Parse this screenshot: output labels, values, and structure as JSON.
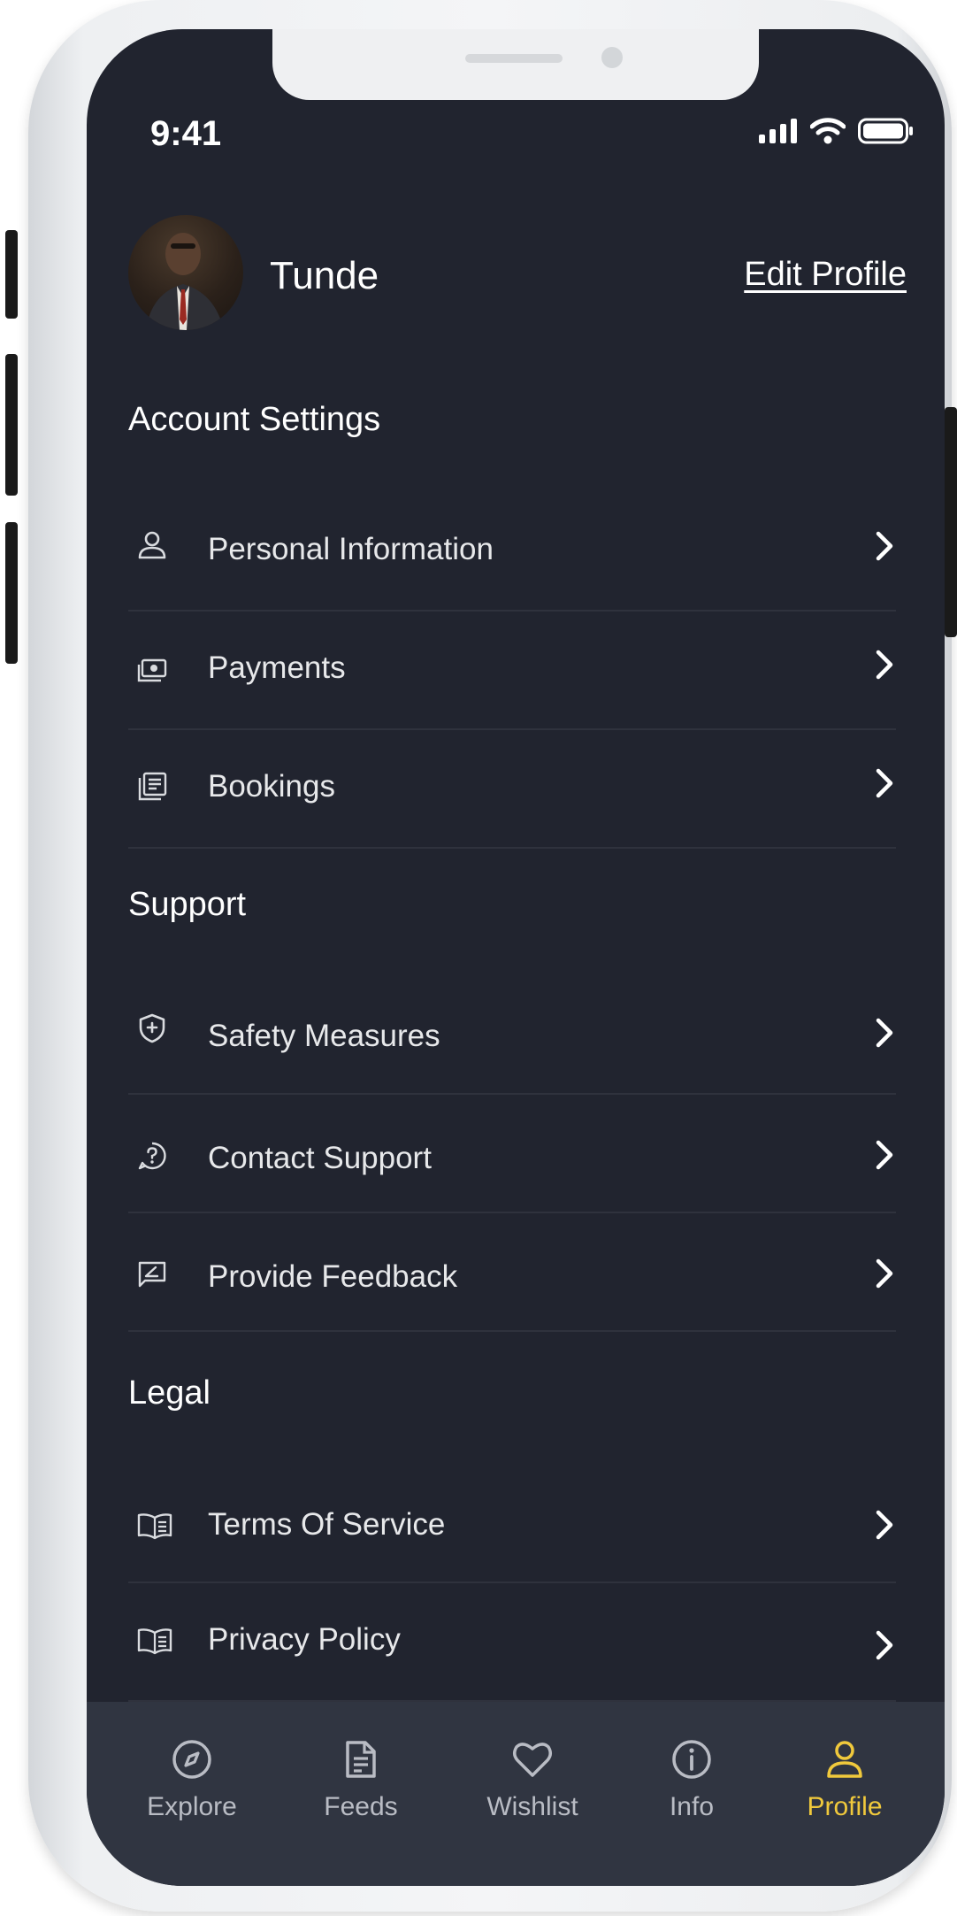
{
  "status": {
    "time": "9:41"
  },
  "profile": {
    "name": "Tunde",
    "edit_label": "Edit Profile"
  },
  "sections": {
    "account": {
      "title": "Account Settings",
      "items": [
        "Personal Information",
        "Payments",
        "Bookings"
      ]
    },
    "support": {
      "title": "Support",
      "items": [
        "Safety Measures",
        "Contact Support",
        "Provide Feedback"
      ]
    },
    "legal": {
      "title": "Legal",
      "items": [
        "Terms Of Service",
        "Privacy Policy"
      ]
    }
  },
  "tabbar": {
    "tabs": [
      {
        "label": "Explore",
        "icon": "compass-icon"
      },
      {
        "label": "Feeds",
        "icon": "document-icon"
      },
      {
        "label": "Wishlist",
        "icon": "heart-icon"
      },
      {
        "label": "Info",
        "icon": "info-icon"
      },
      {
        "label": "Profile",
        "icon": "user-icon"
      }
    ],
    "active": "Profile"
  },
  "colors": {
    "background": "#21242f",
    "tabbar": "#303541",
    "accent": "#f0c93c",
    "text": "#ffffff"
  }
}
